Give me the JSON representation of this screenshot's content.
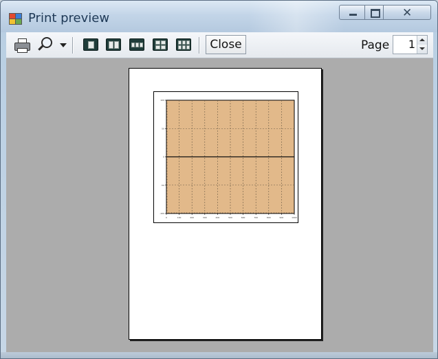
{
  "window": {
    "title": "Print preview"
  },
  "titlebar_buttons": {
    "minimize_icon": "minimize-icon",
    "maximize_icon": "maximize-icon",
    "close_glyph": "✕"
  },
  "toolbar": {
    "print_icon": "printer-icon",
    "zoom_icon": "magnifier-icon",
    "layouts": [
      "one-page",
      "two-pages",
      "three-pages",
      "four-pages",
      "six-pages"
    ],
    "close_label": "Close",
    "page_label": "Page",
    "page_value": "1"
  },
  "preview": {
    "background_color": "#acacac",
    "chart_thumbnail": {
      "plot_background": "#e2b98a"
    }
  },
  "chart_data": {
    "type": "line",
    "title": "",
    "xlabel": "",
    "ylabel": "",
    "xlim": [
      0,
      1000
    ],
    "ylim": [
      -100,
      100
    ],
    "x_ticks": [
      "0",
      "100",
      "200",
      "300",
      "400",
      "500",
      "600",
      "700",
      "800",
      "900",
      "1000"
    ],
    "y_ticks": [
      "100",
      "50",
      "0",
      "-50",
      "-100"
    ],
    "grid": true,
    "series": [
      {
        "x": [
          0,
          1000
        ],
        "y": [
          0,
          0
        ]
      }
    ]
  }
}
